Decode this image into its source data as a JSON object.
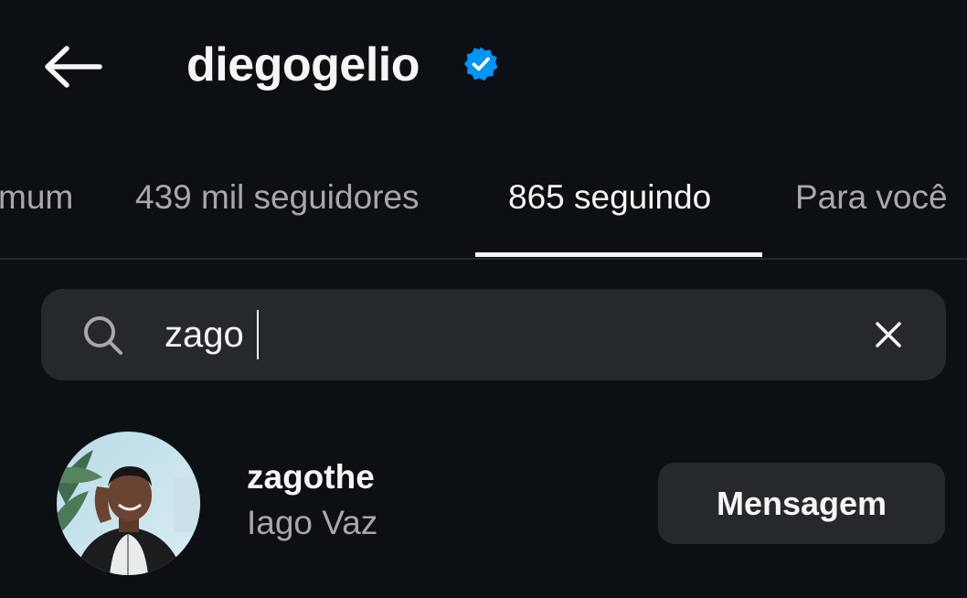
{
  "header": {
    "username": "diegogelio",
    "verified": true,
    "back_icon": "arrow-left-icon",
    "verified_icon": "verified-badge-icon",
    "verified_color": "#0095f6"
  },
  "tabs": [
    {
      "label": "mum",
      "active": false
    },
    {
      "label": "439 mil seguidores",
      "active": false
    },
    {
      "label": "865 seguindo",
      "active": true
    },
    {
      "label": "Para você",
      "active": false
    }
  ],
  "search": {
    "value": "zago",
    "search_icon": "search-icon",
    "clear_icon": "close-icon"
  },
  "results": [
    {
      "username": "zagothe",
      "full_name": "Iago Vaz",
      "button_label": "Mensagem"
    }
  ]
}
